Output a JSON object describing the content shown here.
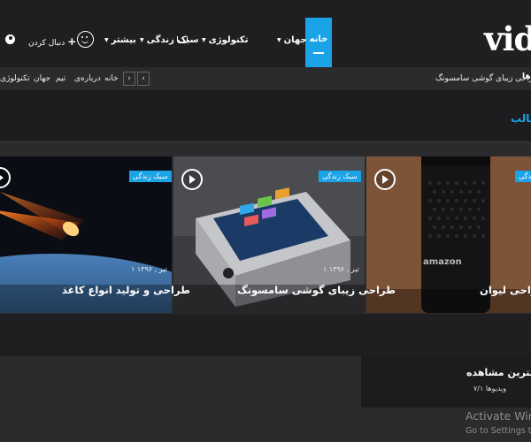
{
  "header": {
    "logo_text": "vide",
    "nav": {
      "home": "خانه",
      "world": "جهان",
      "technology": "تکنولوژی",
      "lifestyle": "سبک زندگی",
      "more": "بیشتر"
    },
    "follow_label": "دنبال کردن",
    "follow_plus": "+"
  },
  "ticker": {
    "headline": "طراحی زیبای گوشی سامسونگ",
    "prev_symbol": "‹",
    "next_symbol": "›",
    "categories": [
      "خانه",
      "دریاره‌ی",
      "تیم",
      "جهان",
      "تکنولوژی"
    ]
  },
  "section": {
    "title_fragment": "طالب"
  },
  "cards": [
    {
      "category": "سبک زندگی",
      "date": "",
      "title": "طراحی لیوان",
      "image_brand_text": "amazon"
    },
    {
      "category": "سبک زندگی",
      "date": "۱ تیر , ۱۳۹۶",
      "title": "طراحی زیبای گوشی سامسونگ"
    },
    {
      "category": "سبک زندگی",
      "date": "۱ تیر , ۱۳۹۶",
      "title": "طراحی و تولید انواع کاغذ"
    }
  ],
  "sidebar": {
    "most_viewed_title": "بیشترین مشاهده",
    "most_viewed_count": "۷/۱ ویدیوها"
  },
  "os_watermark": {
    "title": "Activate Windo",
    "subtitle": "Go to Settings to ac"
  },
  "colors": {
    "accent": "#1aa3e6",
    "header_bg": "#1f1f21",
    "page_bg": "#2b2b2d"
  }
}
